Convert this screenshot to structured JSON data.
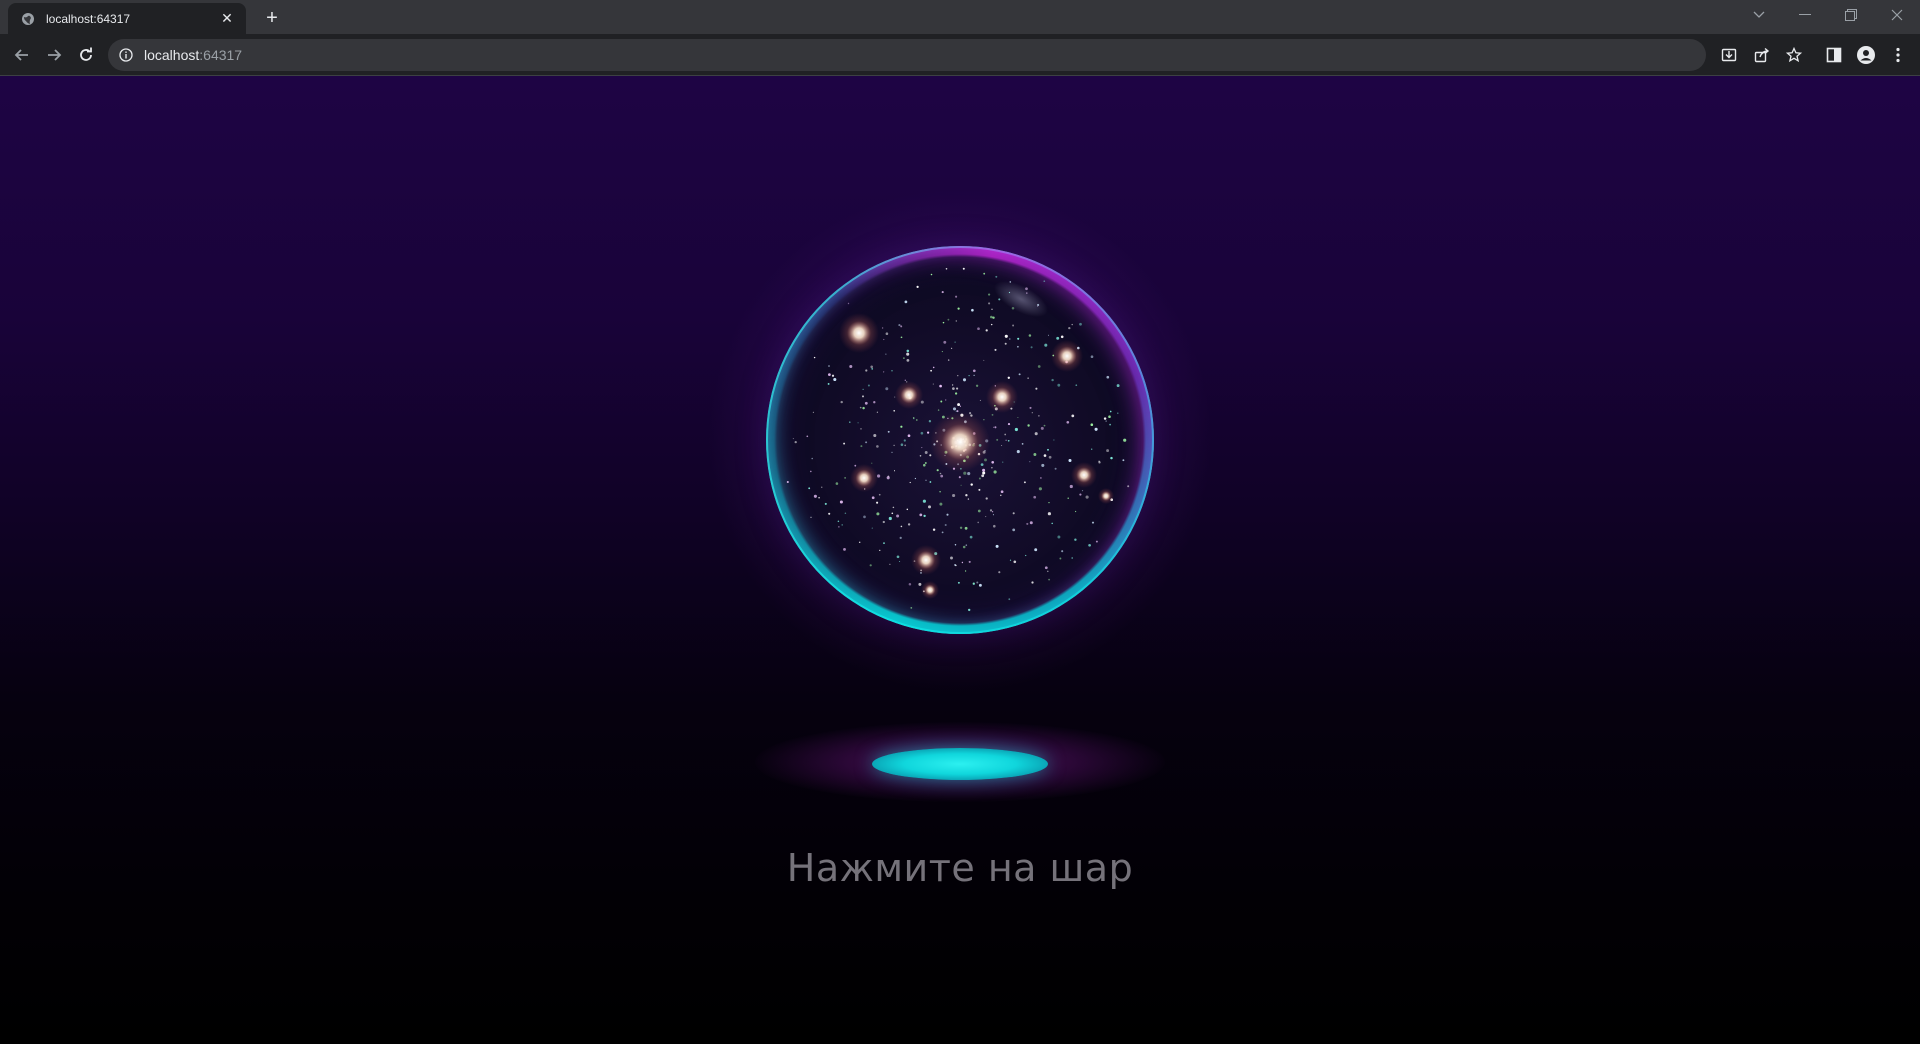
{
  "browser": {
    "tab": {
      "title": "localhost:64317",
      "favicon": "globe-icon",
      "close": "close-icon"
    },
    "new_tab": "plus-icon",
    "window_controls": [
      "tab-search-icon",
      "minimize-icon",
      "restore-icon",
      "close-icon"
    ],
    "nav": [
      "back-icon",
      "forward-icon",
      "reload-icon"
    ],
    "omnibox": {
      "security_icon": "info-icon",
      "host": "localhost",
      "port": ":64317"
    },
    "toolbar_icons": [
      "install-icon",
      "share-icon",
      "bookmark-star-icon",
      "side-panel-icon",
      "profile-icon",
      "menu-icon"
    ]
  },
  "page": {
    "orb": {
      "label": "crystal-ball"
    },
    "prompt": "Нажмите на шар"
  },
  "colors": {
    "background_top": "#1e0444",
    "background_bottom": "#000000",
    "orb_rim_cyan": "#2ce6e6",
    "orb_rim_magenta": "#dc28f0",
    "pedestal_glow": "#10d6dc",
    "prompt_text": "#75727a"
  }
}
